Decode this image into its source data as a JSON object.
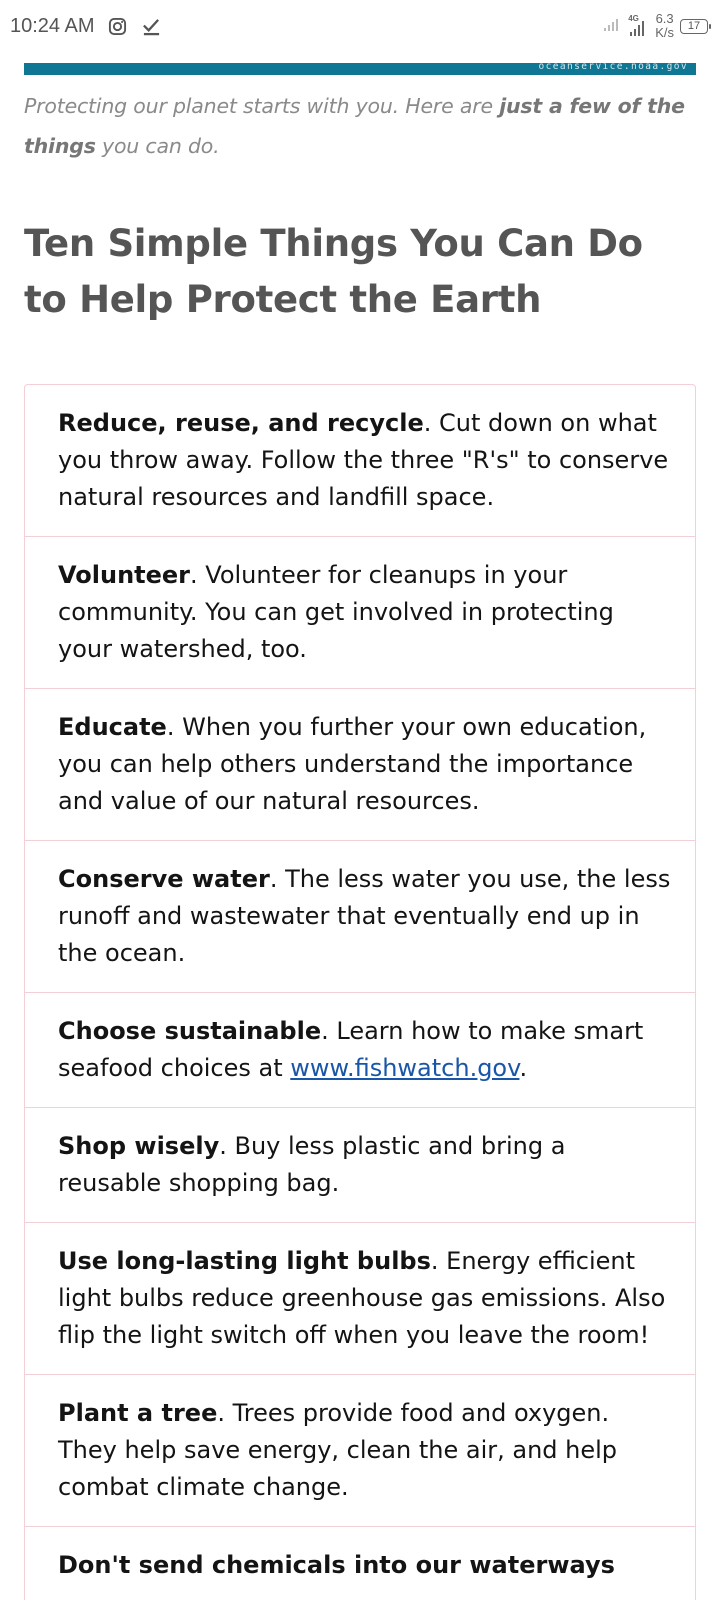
{
  "status_bar": {
    "time": "10:24 AM",
    "icons": [
      "instagram-icon",
      "check-icon"
    ],
    "network_type": "4G",
    "net_speed_value": "6.3",
    "net_speed_unit": "K/s",
    "battery_level": "17"
  },
  "banner": {
    "caption": "oceanservice.noaa.gov",
    "color": "#0f7794"
  },
  "intro": {
    "text_lead": "Protecting our planet starts with you. Here are ",
    "text_bold": "just a few of the things",
    "text_tail": " you can do."
  },
  "page_title": "Ten Simple Things You Can Do to Help Protect the Earth",
  "tips": [
    {
      "title": "Reduce, reuse, and recycle",
      "body": ". Cut down on what you throw away. Follow the three \"R's\" to conserve natural resources and landfill space."
    },
    {
      "title": "Volunteer",
      "body": ". Volunteer for cleanups in your community. You can get involved in protecting your watershed, too."
    },
    {
      "title": "Educate",
      "body": ". When you further your own education, you can help others understand the importance and value of our natural resources."
    },
    {
      "title": "Conserve water",
      "body": ". The less water you use, the less runoff and wastewater that eventually end up in the ocean."
    },
    {
      "title": "Choose sustainable",
      "body": ". Learn how to make smart seafood choices at ",
      "link": "www.fishwatch.gov",
      "tail": "."
    },
    {
      "title": "Shop wisely",
      "body": ". Buy less plastic and bring a reusable shopping bag."
    },
    {
      "title": "Use long-lasting light bulbs",
      "body": ". Energy efficient light bulbs reduce greenhouse gas emissions. Also flip the light switch off when you leave the room!"
    },
    {
      "title": "Plant a tree",
      "body": ". Trees provide food and oxygen. They help save energy, clean the air, and help combat climate change."
    },
    {
      "title": "Don't send chemicals into our waterways",
      "body": ""
    }
  ],
  "colors": {
    "link": "#1a56a8",
    "divider": "#f3cfd6",
    "title": "#555555",
    "intro": "#8a8a8a"
  }
}
